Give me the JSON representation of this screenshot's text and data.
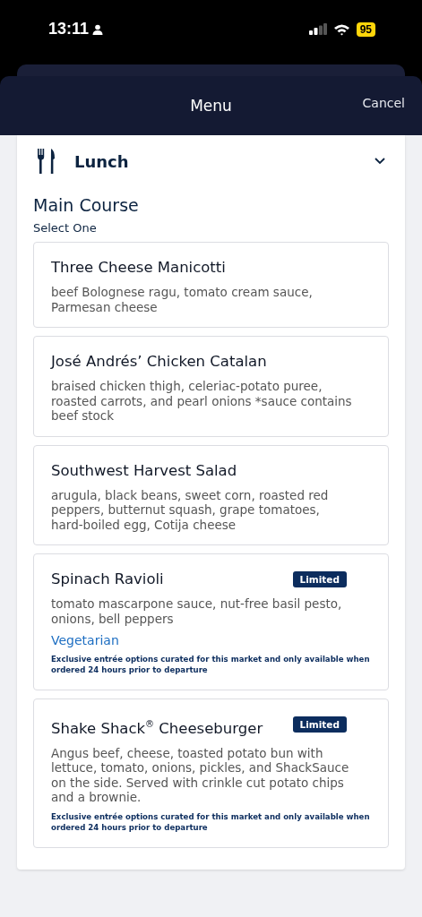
{
  "status_bar": {
    "time": "13:11",
    "battery": "95"
  },
  "header": {
    "title": "Menu",
    "cancel": "Cancel"
  },
  "section": {
    "title": "Lunch",
    "expanded": true
  },
  "course": {
    "title": "Main Course",
    "hint": "Select One"
  },
  "items": [
    {
      "name": "Three Cheese Manicotti",
      "description": "beef Bolognese ragu, tomato cream sauce, Parmesan cheese"
    },
    {
      "name": "José Andrés’ Chicken Catalan",
      "description": "braised chicken thigh, celeriac-potato puree, roasted carrots, and pearl onions *sauce contains beef stock"
    },
    {
      "name": "Southwest Harvest Salad",
      "description": "arugula, black beans, sweet corn, roasted red peppers, butternut squash, grape tomatoes, hard-boiled egg, Cotija cheese"
    },
    {
      "name": "Spinach Ravioli",
      "badge": "Limited",
      "description": "tomato mascarpone sauce, nut-free basil pesto, onions, bell peppers",
      "tag": "Vegetarian",
      "note": "Exclusive entrée options curated for this market and only available when ordered 24 hours prior to departure"
    },
    {
      "name": "Shake Shack$^{®}$ Cheeseburger",
      "badge": "Limited",
      "description": "Angus beef, cheese, toasted potato bun with lettuce, tomato, onions, pickles, and ShackSauce on the side.  Served with crinkle cut potato chips and a brownie.",
      "note": "Exclusive entrée options curated for this market and only available when ordered 24 hours prior to departure"
    }
  ]
}
